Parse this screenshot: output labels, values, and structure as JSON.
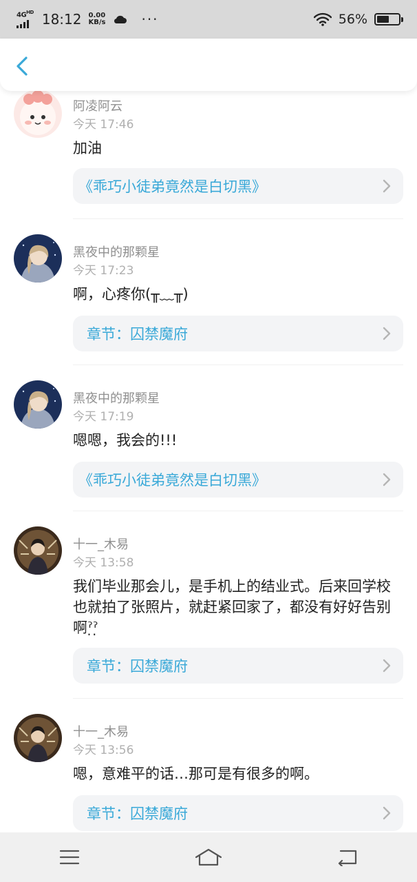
{
  "status_bar": {
    "network": "4G",
    "network_sub": "HD",
    "time": "18:12",
    "speed_value": "0.00",
    "speed_unit": "KB/s",
    "more": "···",
    "battery": "56%",
    "battery_level": 0.56
  },
  "header": {
    "back_icon": "chevron-left-icon",
    "accent": "#3aa9d8"
  },
  "comments": [
    {
      "author": "阿凌阿云",
      "time": "今天 17:46",
      "text": "加油",
      "ref": "《乖巧小徒弟竟然是白切黑》",
      "ref_type": "book"
    },
    {
      "author": "黑夜中的那颗星",
      "time": "今天 17:23",
      "text": "啊，心疼你(╥﹏╥)",
      "ref": "章节：囚禁魔府",
      "ref_type": "chapter"
    },
    {
      "author": "黑夜中的那颗星",
      "time": "今天 17:19",
      "text": "嗯嗯，我会的!!!",
      "ref": "《乖巧小徒弟竟然是白切黑》",
      "ref_type": "book"
    },
    {
      "author": "十一_木易",
      "time": "今天 13:58",
      "text": "我们毕业那会儿，是手机上的结业式。后来回学校也就拍了张照片，就赶紧回家了，都没有好好告别啊ˀ̣ˀ̣",
      "ref": "章节：囚禁魔府",
      "ref_type": "chapter"
    },
    {
      "author": "十一_木易",
      "time": "今天 13:56",
      "text": "嗯，意难平的话…那可是有很多的啊。",
      "ref": "章节：囚禁魔府",
      "ref_type": "chapter"
    }
  ],
  "nav_bar": {
    "menu_icon": "menu-icon",
    "home_icon": "home-icon",
    "back_icon": "back-icon"
  }
}
